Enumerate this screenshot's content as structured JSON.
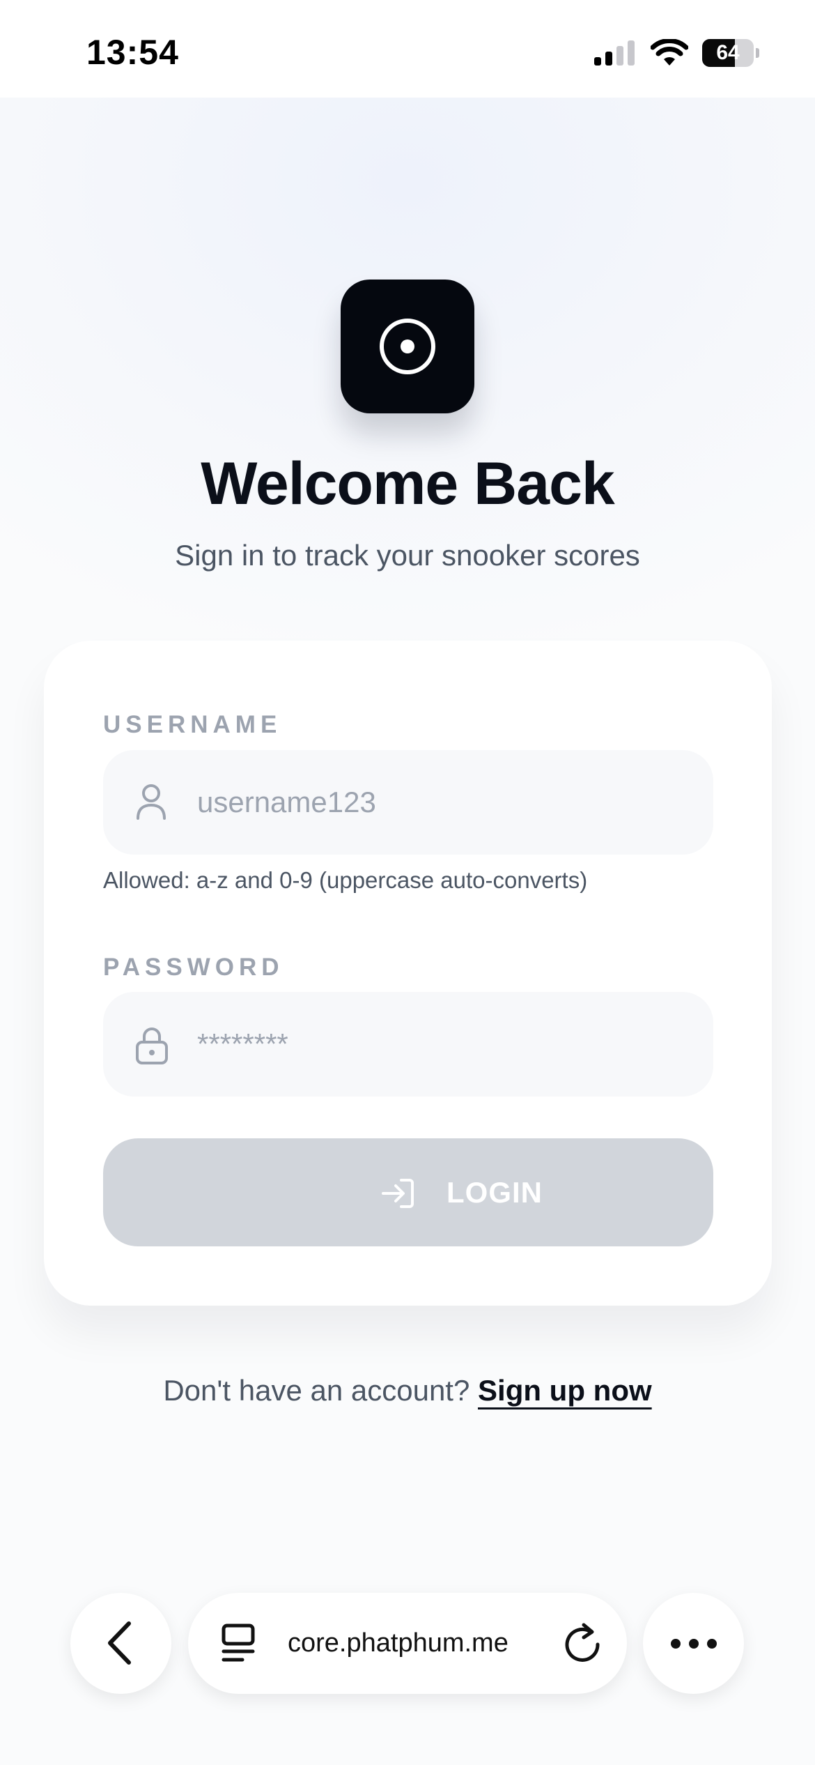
{
  "status_bar": {
    "time": "13:54",
    "battery_level": "64",
    "battery_fraction": 0.64,
    "signal_bars": 2,
    "icons": [
      "cellular-signal-icon",
      "wifi-icon",
      "battery-icon"
    ]
  },
  "header": {
    "app_icon": "target-icon",
    "title": "Welcome Back",
    "subtitle": "Sign in to track your snooker scores"
  },
  "form": {
    "username_label": "USERNAME",
    "username_placeholder": "username123",
    "username_icon": "user-icon",
    "username_hint": "Allowed: a-z and 0-9 (uppercase auto-converts)",
    "password_label": "PASSWORD",
    "password_placeholder": "********",
    "password_icon": "lock-icon",
    "login_label": "LOGIN",
    "login_icon": "login-icon",
    "login_enabled": false
  },
  "signup": {
    "prompt": "Don't have an account?",
    "link": "Sign up now"
  },
  "browser": {
    "url": "core.phatphum.me",
    "icons": [
      "back-arrow-icon",
      "reader-mode-icon",
      "reload-icon",
      "more-icon"
    ]
  },
  "colors": {
    "primary": "#05080f",
    "button_disabled": "#d1d5db",
    "muted_text": "#9ca3af",
    "body_text": "#4b5563",
    "field_bg": "#f7f8fa"
  }
}
